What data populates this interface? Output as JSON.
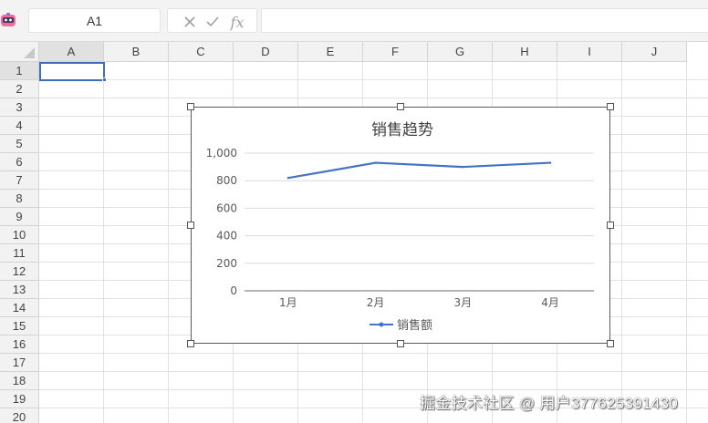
{
  "formula_bar": {
    "name_box": "A1",
    "cancel_icon": "close-icon",
    "confirm_icon": "check-icon",
    "fx_label": "fx",
    "formula_value": ""
  },
  "sheet": {
    "columns": [
      "A",
      "B",
      "C",
      "D",
      "E",
      "F",
      "G",
      "H",
      "I",
      "J"
    ],
    "rows": [
      "1",
      "2",
      "3",
      "4",
      "5",
      "6",
      "7",
      "8",
      "9",
      "10",
      "11",
      "12",
      "13",
      "14",
      "15",
      "16",
      "17",
      "18",
      "19",
      "20"
    ],
    "selected_cell": "A1",
    "accent_color": "#3f6fba"
  },
  "chart_data": {
    "type": "line",
    "title": "销售趋势",
    "categories": [
      "1月",
      "2月",
      "3月",
      "4月"
    ],
    "series": [
      {
        "name": "销售额",
        "values": [
          820,
          930,
          900,
          930
        ],
        "color": "#4472c4"
      }
    ],
    "ylim": [
      0,
      1000
    ],
    "yticks": [
      0,
      200,
      400,
      600,
      800,
      1000
    ],
    "ytick_labels": [
      "0",
      "200",
      "400",
      "600",
      "800",
      "1,000"
    ],
    "grid": true,
    "legend": "bottom"
  },
  "watermark": "掘金技术社区 @ 用户377625391430"
}
